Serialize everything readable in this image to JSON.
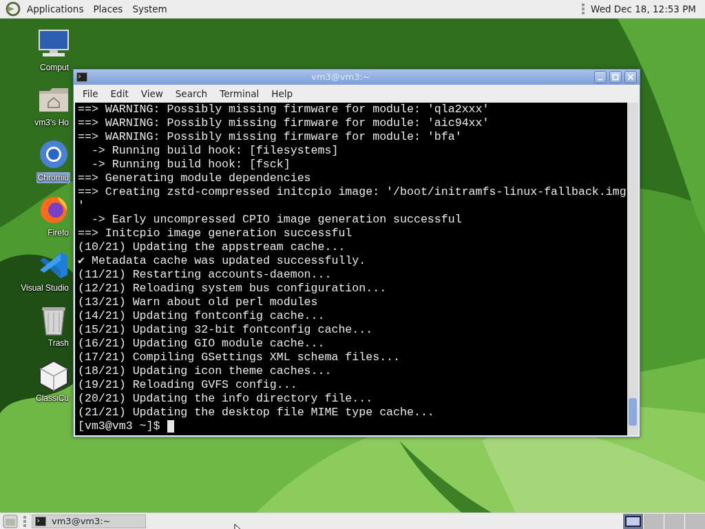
{
  "top_panel": {
    "menus": [
      "Applications",
      "Places",
      "System"
    ],
    "clock": "Wed Dec 18, 12:53 PM"
  },
  "desktop_icons": [
    {
      "kind": "computer",
      "label": "Comput",
      "selected": false
    },
    {
      "kind": "home",
      "label": "vm3's Ho",
      "selected": false
    },
    {
      "kind": "chromium",
      "label": "Chromiu",
      "selected": true
    },
    {
      "kind": "firefox",
      "label": "Firefo",
      "selected": false
    },
    {
      "kind": "vscode",
      "label": "Visual Studio",
      "selected": false
    },
    {
      "kind": "trash",
      "label": "Trash",
      "selected": false
    },
    {
      "kind": "cube",
      "label": "ClassiCu",
      "selected": false
    }
  ],
  "window": {
    "title": "vm3@vm3:~",
    "menu": [
      "File",
      "Edit",
      "View",
      "Search",
      "Terminal",
      "Help"
    ],
    "terminal_lines": [
      "==> WARNING: Possibly missing firmware for module: 'qla2xxx'",
      "==> WARNING: Possibly missing firmware for module: 'aic94xx'",
      "==> WARNING: Possibly missing firmware for module: 'bfa'",
      "  -> Running build hook: [filesystems]",
      "  -> Running build hook: [fsck]",
      "==> Generating module dependencies",
      "==> Creating zstd-compressed initcpio image: '/boot/initramfs-linux-fallback.img",
      "'",
      "  -> Early uncompressed CPIO image generation successful",
      "==> Initcpio image generation successful",
      "(10/21) Updating the appstream cache...",
      "✔ Metadata cache was updated successfully.",
      "(11/21) Restarting accounts-daemon...",
      "(12/21) Reloading system bus configuration...",
      "(13/21) Warn about old perl modules",
      "(14/21) Updating fontconfig cache...",
      "(15/21) Updating 32-bit fontconfig cache...",
      "(16/21) Updating GIO module cache...",
      "(17/21) Compiling GSettings XML schema files...",
      "(18/21) Updating icon theme caches...",
      "(19/21) Reloading GVFS config...",
      "(20/21) Updating the info directory file...",
      "(21/21) Updating the desktop file MIME type cache..."
    ],
    "prompt": "[vm3@vm3 ~]$"
  },
  "bottom_panel": {
    "tasks": [
      {
        "label": "vm3@vm3:~",
        "selected": false
      }
    ],
    "workspaces": [
      {
        "selected": true
      },
      {
        "selected": false
      },
      {
        "selected": false
      },
      {
        "selected": false
      }
    ]
  }
}
